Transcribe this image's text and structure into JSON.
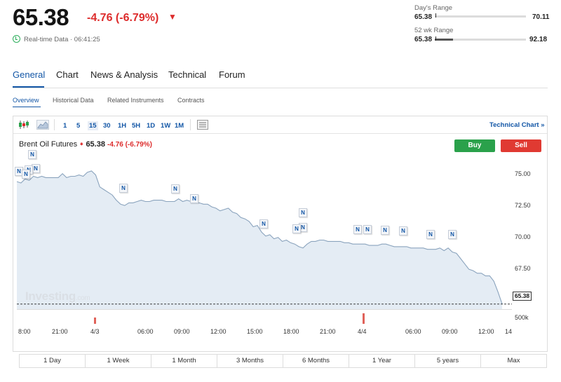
{
  "quote": {
    "price": "65.38",
    "change": "-4.76 (-6.79%)",
    "realtime_label": "Real-time Data · 06:41:25",
    "change_color": "#dd2c2c"
  },
  "ranges": {
    "day_title": "Day's Range",
    "day_low": "65.38",
    "day_high": "70.11",
    "day_position": 0.0,
    "wk52_title": "52 wk Range",
    "wk52_low": "65.38",
    "wk52_high": "92.18",
    "wk52_position": 0.0
  },
  "tabs": [
    "General",
    "Chart",
    "News & Analysis",
    "Technical",
    "Forum"
  ],
  "subtabs": [
    "Overview",
    "Historical Data",
    "Related Instruments",
    "Contracts"
  ],
  "toolbar": {
    "intervals": [
      "1",
      "5",
      "15",
      "30",
      "1H",
      "5H",
      "1D",
      "1W",
      "1M"
    ],
    "active_interval": "15",
    "icons": [
      "candlestick-icon",
      "area-chart-icon",
      "table-icon"
    ],
    "technical_chart_label": "Technical Chart »"
  },
  "instrument": {
    "name": "Brent Oil Futures",
    "price": "65.38",
    "change": "-4.76 (-6.79%)"
  },
  "actions": {
    "buy": "Buy",
    "sell": "Sell",
    "buy_color": "#2aa14b",
    "sell_color": "#e03a32"
  },
  "watermark": {
    "brand": "Investing",
    "suffix": ".com"
  },
  "chart_data": {
    "type": "area",
    "y_ticks": [
      "75.00",
      "72.50",
      "70.00",
      "67.50"
    ],
    "ylim": [
      65.0,
      76.4
    ],
    "x_ticks": [
      "8:00",
      "21:00",
      "4/3",
      "06:00",
      "09:00",
      "12:00",
      "15:00",
      "18:00",
      "21:00",
      "4/4",
      "06:00",
      "09:00",
      "12:00",
      "14"
    ],
    "volume_label": "500k",
    "last_price_tag": "65.38",
    "series": [
      {
        "values": [
          74.6,
          74.5,
          74.8,
          74.7,
          75.0,
          74.9,
          75.0,
          74.9,
          74.9,
          74.9,
          74.9,
          75.2,
          74.9,
          75.0,
          75.0,
          75.1,
          75.0,
          75.3,
          75.4,
          75.1,
          74.2,
          74.0,
          73.8,
          73.6,
          73.2,
          72.9,
          72.8,
          73.0,
          73.0,
          73.1,
          73.2,
          73.1,
          73.1,
          73.2,
          73.2,
          73.2,
          73.1,
          73.1,
          73.1,
          73.3,
          73.1,
          73.2,
          73.1,
          73.0,
          73.0,
          72.9,
          72.9,
          72.7,
          72.6,
          72.4,
          72.5,
          72.6,
          72.3,
          72.2,
          71.9,
          71.8,
          71.6,
          71.2,
          71.3,
          70.8,
          70.5,
          70.6,
          70.3,
          70.4,
          70.1,
          70.2,
          70.0,
          69.9,
          69.7,
          69.6,
          69.9,
          70.1,
          70.1,
          70.2,
          70.2,
          70.1,
          70.1,
          70.1,
          70.1,
          70.0,
          70.0,
          69.9,
          69.9,
          69.9,
          69.9,
          69.8,
          69.8,
          69.8,
          69.9,
          69.9,
          69.8,
          69.7,
          69.7,
          69.7,
          69.7,
          69.6,
          69.6,
          69.6,
          69.6,
          69.5,
          69.5,
          69.5,
          69.6,
          69.4,
          69.6,
          69.3,
          69.2,
          68.8,
          68.4,
          68.0,
          67.9,
          67.7,
          67.7,
          67.5,
          67.5,
          67.1,
          66.3,
          65.4
        ]
      }
    ],
    "news_markers": 20,
    "volume_bars": [
      0.06,
      0.92
    ]
  },
  "periods": [
    "1 Day",
    "1 Week",
    "1 Month",
    "3 Months",
    "6 Months",
    "1 Year",
    "5 years",
    "Max"
  ]
}
